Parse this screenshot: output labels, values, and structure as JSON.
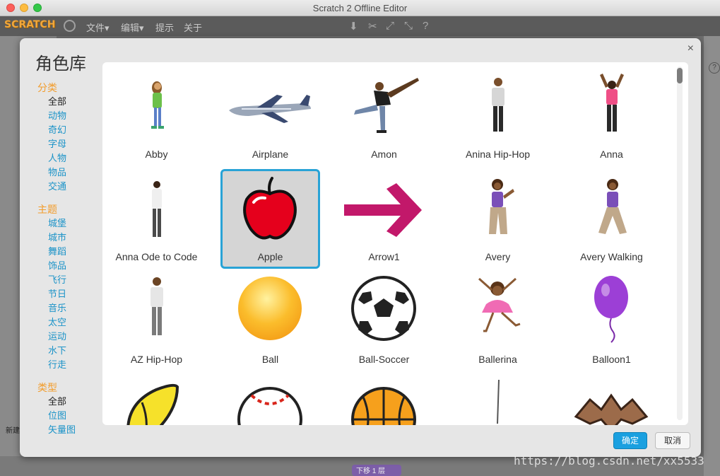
{
  "window": {
    "title": "Scratch 2 Offline Editor"
  },
  "menubar": {
    "logo": "SCRATCH",
    "items": [
      "文件▾",
      "编辑▾",
      "提示",
      "关于"
    ]
  },
  "dialog": {
    "title": "角色库",
    "close": "×",
    "categories": {
      "head": "分类",
      "items": [
        "全部",
        "动物",
        "奇幻",
        "字母",
        "人物",
        "物品",
        "交通"
      ]
    },
    "themes": {
      "head": "主题",
      "items": [
        "城堡",
        "城市",
        "舞蹈",
        "饰品",
        "飞行",
        "节日",
        "音乐",
        "太空",
        "运动",
        "水下",
        "行走"
      ]
    },
    "types": {
      "head": "类型",
      "items": [
        "全部",
        "位图",
        "矢量图"
      ]
    },
    "sprites": [
      {
        "name": "Abby"
      },
      {
        "name": "Airplane"
      },
      {
        "name": "Amon"
      },
      {
        "name": "Anina Hip-Hop"
      },
      {
        "name": "Anna"
      },
      {
        "name": "Anna Ode to Code"
      },
      {
        "name": "Apple"
      },
      {
        "name": "Arrow1"
      },
      {
        "name": "Avery"
      },
      {
        "name": "Avery Walking"
      },
      {
        "name": "AZ Hip-Hop"
      },
      {
        "name": "Ball"
      },
      {
        "name": "Ball-Soccer"
      },
      {
        "name": "Ballerina"
      },
      {
        "name": "Balloon1"
      }
    ],
    "ok": "确定",
    "cancel": "取消"
  },
  "background": {
    "new_label": "新建",
    "pill": "下移 1 层",
    "watermark": "https://blog.csdn.net/xx5533"
  }
}
